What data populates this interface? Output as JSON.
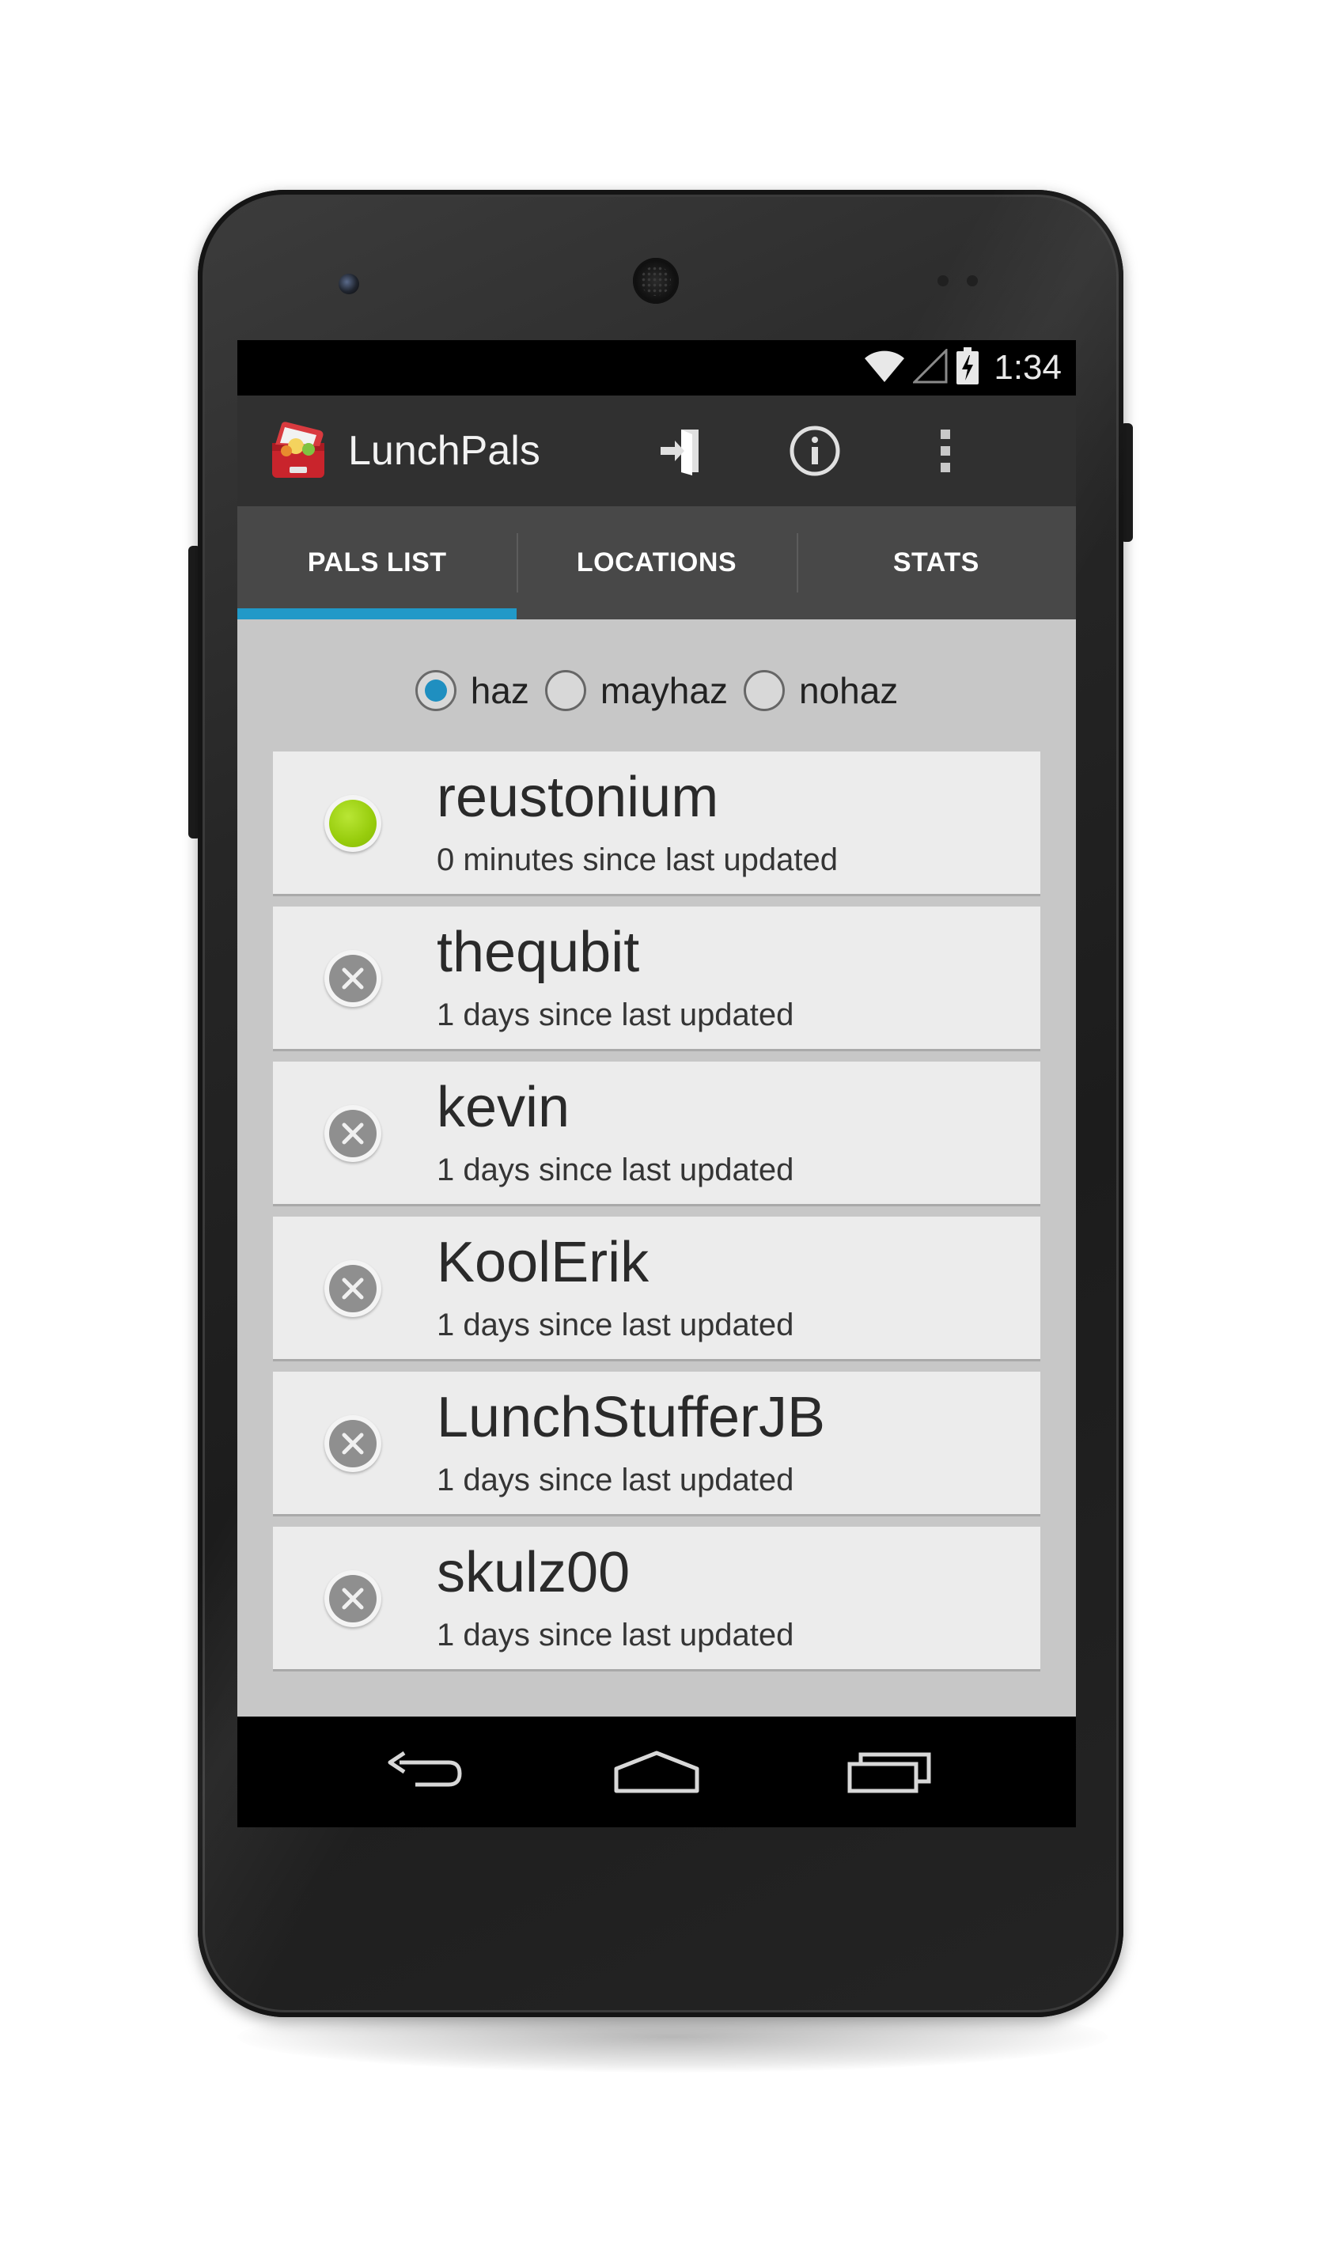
{
  "status_bar": {
    "time": "1:34",
    "icons": [
      "wifi-icon",
      "signal-icon",
      "battery-charging-icon"
    ]
  },
  "action_bar": {
    "app_title": "LunchPals",
    "actions": [
      "sign-out-icon",
      "info-icon",
      "overflow-menu-icon"
    ]
  },
  "tabs": [
    {
      "label": "PALS LIST",
      "active": true
    },
    {
      "label": "LOCATIONS",
      "active": false
    },
    {
      "label": "STATS",
      "active": false
    }
  ],
  "filter": {
    "options": [
      {
        "label": "haz",
        "checked": true
      },
      {
        "label": "mayhaz",
        "checked": false
      },
      {
        "label": "nohaz",
        "checked": false
      }
    ]
  },
  "pals": [
    {
      "name": "reustonium",
      "status": "online",
      "updated": "0 minutes since last updated"
    },
    {
      "name": "thequbit",
      "status": "offline",
      "updated": "1 days since last updated"
    },
    {
      "name": "kevin",
      "status": "offline",
      "updated": "1 days since last updated"
    },
    {
      "name": "KoolErik",
      "status": "offline",
      "updated": "1 days since last updated"
    },
    {
      "name": "LunchStufferJB",
      "status": "offline",
      "updated": "1 days since last updated"
    },
    {
      "name": "skulz00",
      "status": "offline",
      "updated": "1 days since last updated"
    }
  ],
  "nav_bar": {
    "buttons": [
      "back-icon",
      "home-icon",
      "recents-icon"
    ]
  },
  "colors": {
    "tab_indicator": "#2199c8",
    "online_dot": "#97cc0c",
    "offline_dot": "#8f8f8f",
    "action_bar": "#303030",
    "content_bg": "#c7c7c7"
  }
}
